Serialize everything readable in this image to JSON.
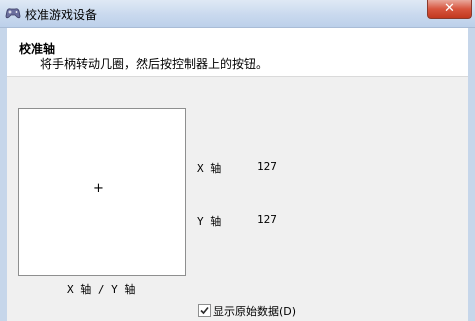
{
  "window": {
    "title": "校准游戏设备",
    "close_glyph": "✕",
    "icon": "game-controller-icon"
  },
  "header": {
    "title": "校准轴",
    "instruction": "将手柄转动几圈，然后按控制器上的按钮。"
  },
  "axis_area": {
    "crosshair": "+",
    "caption": "X 轴 / Y 轴"
  },
  "readouts": {
    "x": {
      "label": "X 轴",
      "value": "127"
    },
    "y": {
      "label": "Y 轴",
      "value": "127"
    }
  },
  "raw_data_checkbox": {
    "label": "显示原始数据(D)",
    "checked": true
  }
}
